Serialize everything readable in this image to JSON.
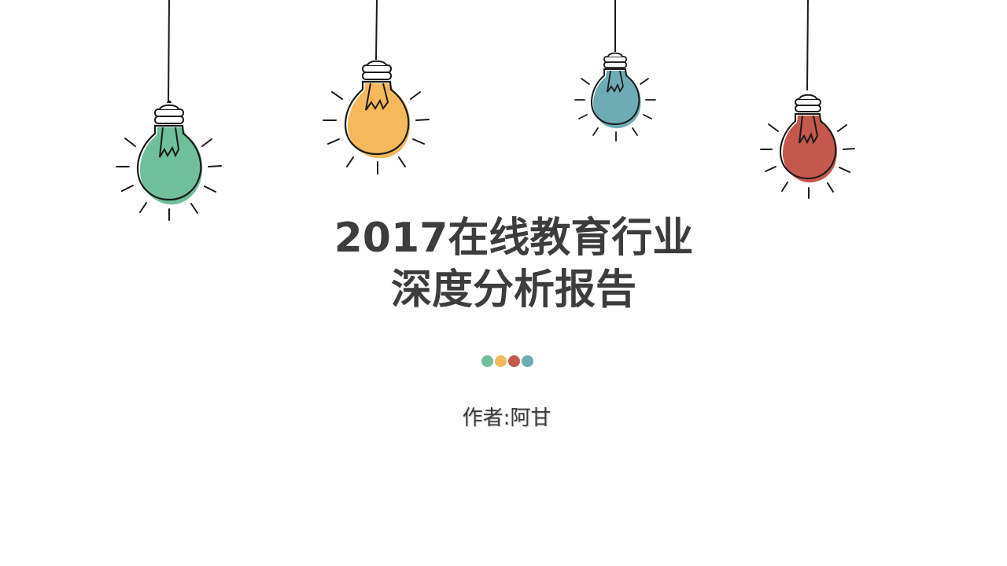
{
  "slide": {
    "title_line1": "2017在线教育行业",
    "title_line2": "深度分析报告",
    "author": "作者:阿甘"
  },
  "colors": {
    "text": "#3d3d3d",
    "green": "#6fbf9c",
    "yellow": "#f5b85a",
    "teal": "#6eabb3",
    "red": "#c4584a",
    "outline": "#1a1a1a"
  },
  "bulbs": [
    {
      "name": "green-bulb-icon",
      "color": "#6fbf9c"
    },
    {
      "name": "yellow-bulb-icon",
      "color": "#f5b85a"
    },
    {
      "name": "teal-bulb-icon",
      "color": "#6eabb3"
    },
    {
      "name": "red-bulb-icon",
      "color": "#c4584a"
    }
  ],
  "dots": [
    "#6fbf9c",
    "#f5b85a",
    "#c4584a",
    "#6eabb3"
  ]
}
